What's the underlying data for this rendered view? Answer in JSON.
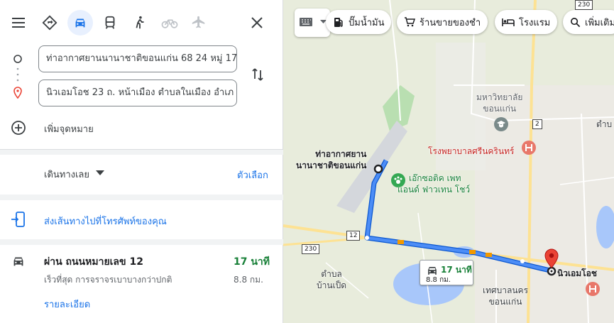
{
  "modes": [
    "best-icon",
    "car-icon",
    "transit-icon",
    "walk-icon",
    "bike-icon",
    "flight-icon"
  ],
  "origin": "ท่าอากาศยานนานาชาติขอนแก่น 68 24 หมู่ 17",
  "destination": "นิวเอมโอช 23 ถ. หน้าเมือง ตำบลในเมือง อำเภ",
  "add_destination": "เพิ่มจุดหมาย",
  "depart": "เดินทางเลย",
  "options": "ตัวเลือก",
  "send_to_phone": "ส่งเส้นทางไปที่โทรศัพท์ของคุณ",
  "route": {
    "via": "ผ่าน ถนนหมายเลข 12",
    "time": "17 นาที",
    "desc": "เร็วที่สุด การจราจรเบาบางกว่าปกติ",
    "distance": "8.8 กม.",
    "details": "รายละเอียด"
  },
  "chips": [
    "ปั๊มน้ำมัน",
    "ร้านขายของชำ",
    "โรงแรม",
    "เพิ่มเติม"
  ],
  "map": {
    "airport": [
      "ท่าอากาศยาน",
      "นานาชาติขอนแก่น"
    ],
    "university": [
      "มหาวิทยาลัย",
      "ขอนแก่น"
    ],
    "hospital": "โรงพยาบาลศรีนครินทร์",
    "zoo": [
      "เอ๊กซอติค เพท",
      "แอนด์ ฟาวเทน โชว์"
    ],
    "tambon": [
      "ตำบล",
      "บ้านเป็ด"
    ],
    "municipality": [
      "เทศบาลนคร",
      "ขอนแก่น"
    ],
    "dest": "นิวเอมโอช",
    "tambon_right": "ตำบ",
    "callout_time": "17 นาที",
    "callout_dist": "8.8 กม.",
    "shields": [
      "230",
      "12",
      "230",
      "2"
    ]
  },
  "colors": {
    "route": "#1a73e8",
    "accent": "#1a73e8",
    "green": "#188038",
    "pin": "#ea4335"
  }
}
